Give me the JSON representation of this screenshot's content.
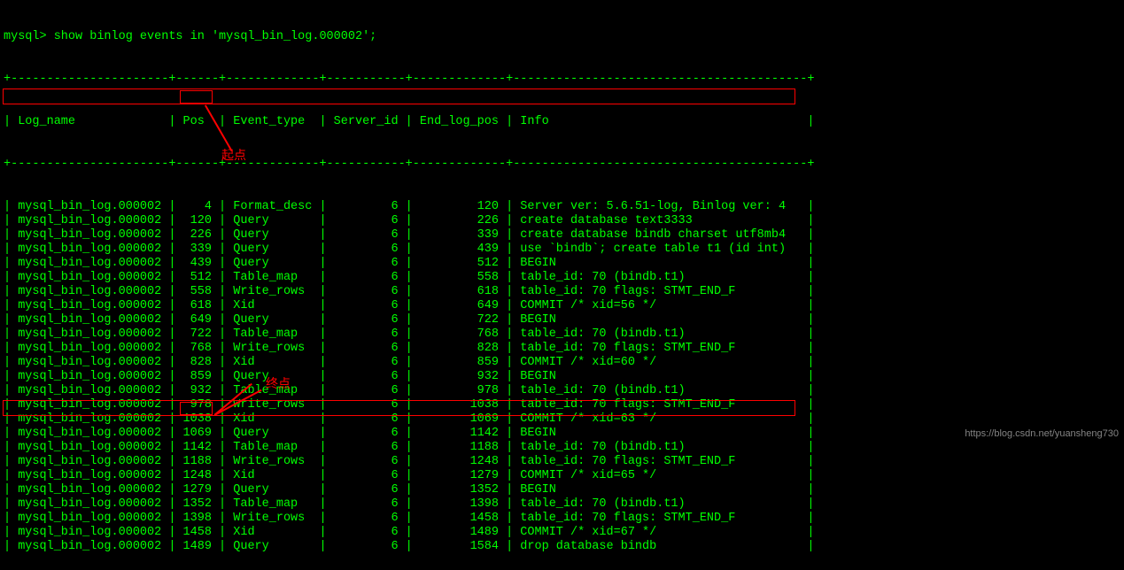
{
  "prompt": "mysql> show binlog events in 'mysql_bin_log.000002';",
  "border_top": "+----------------------+------+-------------+-----------+-------------+-----------------------------------------+",
  "header_row": "| Log_name             | Pos  | Event_type  | Server_id | End_log_pos | Info                                    |",
  "border_mid": "+----------------------+------+-------------+-----------+-------------+-----------------------------------------+",
  "rows": [
    {
      "log": "mysql_bin_log.000002",
      "pos": "4",
      "etype": "Format_desc",
      "sid": "6",
      "end": "120",
      "info": "Server ver: 5.6.51-log, Binlog ver: 4"
    },
    {
      "log": "mysql_bin_log.000002",
      "pos": "120",
      "etype": "Query",
      "sid": "6",
      "end": "226",
      "info": "create database text3333"
    },
    {
      "log": "mysql_bin_log.000002",
      "pos": "226",
      "etype": "Query",
      "sid": "6",
      "end": "339",
      "info": "create database bindb charset utf8mb4"
    },
    {
      "log": "mysql_bin_log.000002",
      "pos": "339",
      "etype": "Query",
      "sid": "6",
      "end": "439",
      "info": "use `bindb`; create table t1 (id int)"
    },
    {
      "log": "mysql_bin_log.000002",
      "pos": "439",
      "etype": "Query",
      "sid": "6",
      "end": "512",
      "info": "BEGIN"
    },
    {
      "log": "mysql_bin_log.000002",
      "pos": "512",
      "etype": "Table_map",
      "sid": "6",
      "end": "558",
      "info": "table_id: 70 (bindb.t1)"
    },
    {
      "log": "mysql_bin_log.000002",
      "pos": "558",
      "etype": "Write_rows",
      "sid": "6",
      "end": "618",
      "info": "table_id: 70 flags: STMT_END_F"
    },
    {
      "log": "mysql_bin_log.000002",
      "pos": "618",
      "etype": "Xid",
      "sid": "6",
      "end": "649",
      "info": "COMMIT /* xid=56 */"
    },
    {
      "log": "mysql_bin_log.000002",
      "pos": "649",
      "etype": "Query",
      "sid": "6",
      "end": "722",
      "info": "BEGIN"
    },
    {
      "log": "mysql_bin_log.000002",
      "pos": "722",
      "etype": "Table_map",
      "sid": "6",
      "end": "768",
      "info": "table_id: 70 (bindb.t1)"
    },
    {
      "log": "mysql_bin_log.000002",
      "pos": "768",
      "etype": "Write_rows",
      "sid": "6",
      "end": "828",
      "info": "table_id: 70 flags: STMT_END_F"
    },
    {
      "log": "mysql_bin_log.000002",
      "pos": "828",
      "etype": "Xid",
      "sid": "6",
      "end": "859",
      "info": "COMMIT /* xid=60 */"
    },
    {
      "log": "mysql_bin_log.000002",
      "pos": "859",
      "etype": "Query",
      "sid": "6",
      "end": "932",
      "info": "BEGIN"
    },
    {
      "log": "mysql_bin_log.000002",
      "pos": "932",
      "etype": "Table_map",
      "sid": "6",
      "end": "978",
      "info": "table_id: 70 (bindb.t1)"
    },
    {
      "log": "mysql_bin_log.000002",
      "pos": "978",
      "etype": "Write_rows",
      "sid": "6",
      "end": "1038",
      "info": "table_id: 70 flags: STMT_END_F"
    },
    {
      "log": "mysql_bin_log.000002",
      "pos": "1038",
      "etype": "Xid",
      "sid": "6",
      "end": "1069",
      "info": "COMMIT /* xid=63 */"
    },
    {
      "log": "mysql_bin_log.000002",
      "pos": "1069",
      "etype": "Query",
      "sid": "6",
      "end": "1142",
      "info": "BEGIN"
    },
    {
      "log": "mysql_bin_log.000002",
      "pos": "1142",
      "etype": "Table_map",
      "sid": "6",
      "end": "1188",
      "info": "table_id: 70 (bindb.t1)"
    },
    {
      "log": "mysql_bin_log.000002",
      "pos": "1188",
      "etype": "Write_rows",
      "sid": "6",
      "end": "1248",
      "info": "table_id: 70 flags: STMT_END_F"
    },
    {
      "log": "mysql_bin_log.000002",
      "pos": "1248",
      "etype": "Xid",
      "sid": "6",
      "end": "1279",
      "info": "COMMIT /* xid=65 */"
    },
    {
      "log": "mysql_bin_log.000002",
      "pos": "1279",
      "etype": "Query",
      "sid": "6",
      "end": "1352",
      "info": "BEGIN"
    },
    {
      "log": "mysql_bin_log.000002",
      "pos": "1352",
      "etype": "Table_map",
      "sid": "6",
      "end": "1398",
      "info": "table_id: 70 (bindb.t1)"
    },
    {
      "log": "mysql_bin_log.000002",
      "pos": "1398",
      "etype": "Write_rows",
      "sid": "6",
      "end": "1458",
      "info": "table_id: 70 flags: STMT_END_F"
    },
    {
      "log": "mysql_bin_log.000002",
      "pos": "1458",
      "etype": "Xid",
      "sid": "6",
      "end": "1489",
      "info": "COMMIT /* xid=67 */"
    },
    {
      "log": "mysql_bin_log.000002",
      "pos": "1489",
      "etype": "Query",
      "sid": "6",
      "end": "1584",
      "info": "drop database bindb"
    }
  ],
  "annotations": {
    "start_label": "起点",
    "end_label": "终点"
  },
  "watermark": "https://blog.csdn.net/yuansheng730",
  "chart_data": {
    "type": "table",
    "title": "show binlog events in 'mysql_bin_log.000002'",
    "columns": [
      "Log_name",
      "Pos",
      "Event_type",
      "Server_id",
      "End_log_pos",
      "Info"
    ],
    "rows": [
      [
        "mysql_bin_log.000002",
        4,
        "Format_desc",
        6,
        120,
        "Server ver: 5.6.51-log, Binlog ver: 4"
      ],
      [
        "mysql_bin_log.000002",
        120,
        "Query",
        6,
        226,
        "create database text3333"
      ],
      [
        "mysql_bin_log.000002",
        226,
        "Query",
        6,
        339,
        "create database bindb charset utf8mb4"
      ],
      [
        "mysql_bin_log.000002",
        339,
        "Query",
        6,
        439,
        "use `bindb`; create table t1 (id int)"
      ],
      [
        "mysql_bin_log.000002",
        439,
        "Query",
        6,
        512,
        "BEGIN"
      ],
      [
        "mysql_bin_log.000002",
        512,
        "Table_map",
        6,
        558,
        "table_id: 70 (bindb.t1)"
      ],
      [
        "mysql_bin_log.000002",
        558,
        "Write_rows",
        6,
        618,
        "table_id: 70 flags: STMT_END_F"
      ],
      [
        "mysql_bin_log.000002",
        618,
        "Xid",
        6,
        649,
        "COMMIT /* xid=56 */"
      ],
      [
        "mysql_bin_log.000002",
        649,
        "Query",
        6,
        722,
        "BEGIN"
      ],
      [
        "mysql_bin_log.000002",
        722,
        "Table_map",
        6,
        768,
        "table_id: 70 (bindb.t1)"
      ],
      [
        "mysql_bin_log.000002",
        768,
        "Write_rows",
        6,
        828,
        "table_id: 70 flags: STMT_END_F"
      ],
      [
        "mysql_bin_log.000002",
        828,
        "Xid",
        6,
        859,
        "COMMIT /* xid=60 */"
      ],
      [
        "mysql_bin_log.000002",
        859,
        "Query",
        6,
        932,
        "BEGIN"
      ],
      [
        "mysql_bin_log.000002",
        932,
        "Table_map",
        6,
        978,
        "table_id: 70 (bindb.t1)"
      ],
      [
        "mysql_bin_log.000002",
        978,
        "Write_rows",
        6,
        1038,
        "table_id: 70 flags: STMT_END_F"
      ],
      [
        "mysql_bin_log.000002",
        1038,
        "Xid",
        6,
        1069,
        "COMMIT /* xid=63 */"
      ],
      [
        "mysql_bin_log.000002",
        1069,
        "Query",
        6,
        1142,
        "BEGIN"
      ],
      [
        "mysql_bin_log.000002",
        1142,
        "Table_map",
        6,
        1188,
        "table_id: 70 (bindb.t1)"
      ],
      [
        "mysql_bin_log.000002",
        1188,
        "Write_rows",
        6,
        1248,
        "table_id: 70 flags: STMT_END_F"
      ],
      [
        "mysql_bin_log.000002",
        1248,
        "Xid",
        6,
        1279,
        "COMMIT /* xid=65 */"
      ],
      [
        "mysql_bin_log.000002",
        1279,
        "Query",
        6,
        1352,
        "BEGIN"
      ],
      [
        "mysql_bin_log.000002",
        1352,
        "Table_map",
        6,
        1398,
        "table_id: 70 (bindb.t1)"
      ],
      [
        "mysql_bin_log.000002",
        1398,
        "Write_rows",
        6,
        1458,
        "table_id: 70 flags: STMT_END_F"
      ],
      [
        "mysql_bin_log.000002",
        1458,
        "Xid",
        6,
        1489,
        "COMMIT /* xid=67 */"
      ],
      [
        "mysql_bin_log.000002",
        1489,
        "Query",
        6,
        1584,
        "drop database bindb"
      ]
    ]
  }
}
